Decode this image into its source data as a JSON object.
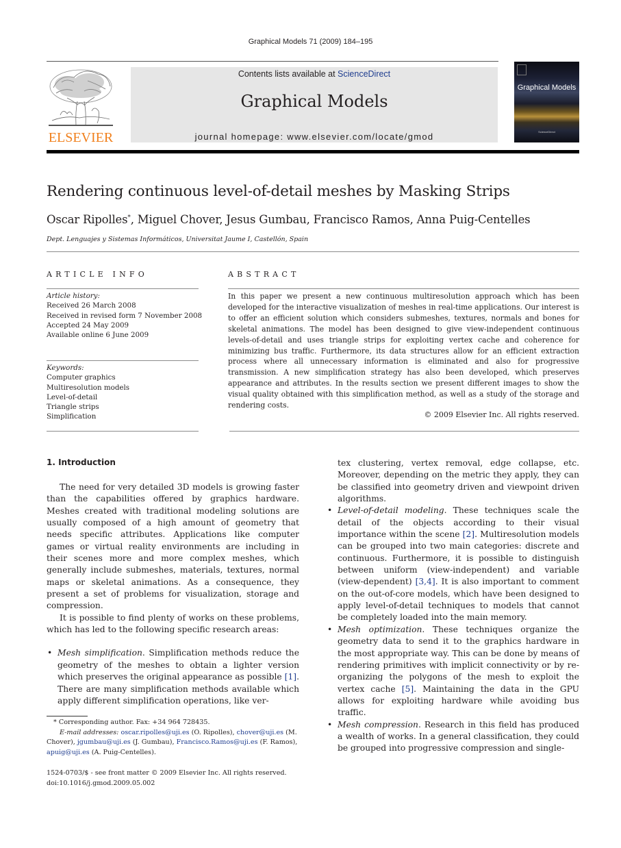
{
  "running_head": "Graphical Models 71 (2009) 184–195",
  "publisher": {
    "logo_icon": "elsevier-tree-logo",
    "name": "ELSEVIER",
    "brand_color": "#f07f1b"
  },
  "banner": {
    "contents_prefix": "Contents lists available at ",
    "contents_link": "ScienceDirect",
    "journal_title": "Graphical Models",
    "homepage": "journal homepage: www.elsevier.com/locate/gmod",
    "background_color": "#e6e6e6",
    "link_color": "#1f3d8f"
  },
  "cover": {
    "title": "Graphical Models",
    "footer": "ScienceDirect"
  },
  "article": {
    "title": "Rendering continuous level-of-detail meshes by Masking Strips",
    "authors": [
      {
        "name": "Oscar Ripolles",
        "mark": "*"
      },
      {
        "name": "Miguel Chover",
        "mark": ""
      },
      {
        "name": "Jesus Gumbau",
        "mark": ""
      },
      {
        "name": "Francisco Ramos",
        "mark": ""
      },
      {
        "name": "Anna Puig-Centelles",
        "mark": ""
      }
    ],
    "affiliation": "Dept. Lenguajes y Sistemas Informáticos, Universitat Jaume I, Castellón, Spain"
  },
  "article_info": {
    "heading": "ARTICLE INFO",
    "history_label": "Article history:",
    "history": [
      "Received 26 March 2008",
      "Received in revised form 7 November 2008",
      "Accepted 24 May 2009",
      "Available online 6 June 2009"
    ],
    "keywords_label": "Keywords:",
    "keywords": [
      "Computer graphics",
      "Multiresolution models",
      "Level-of-detail",
      "Triangle strips",
      "Simplification"
    ]
  },
  "abstract": {
    "heading": "ABSTRACT",
    "text": "In this paper we present a new continuous multiresolution approach which has been developed for the interactive visualization of meshes in real-time applications. Our interest is to offer an efficient solution which considers submeshes, textures, normals and bones for skeletal animations. The model has been designed to give view-independent continuous levels-of-detail and uses triangle strips for exploiting vertex cache and coherence for minimizing bus traffic. Furthermore, its data structures allow for an efficient extraction process where all unnecessary information is eliminated and also for progressive transmission. A new simplification strategy has also been developed, which preserves appearance and attributes. In the results section we present different images to show the visual quality obtained with this simplification method, as well as a study of the storage and rendering costs.",
    "copyright": "© 2009 Elsevier Inc. All rights reserved."
  },
  "body": {
    "section_heading": "1.  Introduction",
    "left_col": {
      "p1": "The need for very detailed 3D models is growing faster than the capabilities offered by graphics hardware. Meshes created with traditional modeling solutions are usually composed of a high amount of geometry that needs specific attributes. Applications like computer games or virtual reality environments are including in their scenes more and more complex meshes, which generally include submeshes, materials, textures, normal maps or skeletal animations. As a consequence, they present a set of problems for visualization, storage and compression.",
      "p2": "It is possible to find plenty of works on these problems, which has led to the following specific research areas:",
      "bullet1": {
        "term": "Mesh simplification",
        "text_a": ". Simplification methods reduce the geometry of the meshes to obtain a lighter version which preserves the original appearance as possible ",
        "cite": "[1]",
        "text_b": ". There are many simplification methods available which apply different simplification operations, like ver-"
      }
    },
    "right_col": {
      "cont": "tex clustering, vertex removal, edge collapse, etc. Moreover, depending on the metric they apply, they can be classified into geometry driven and viewpoint driven algorithms.",
      "bullet2": {
        "term": "Level-of-detail modeling",
        "text_a": ". These techniques scale the detail of the objects according to their visual importance within the scene ",
        "cite1": "[2]",
        "text_b": ". Multiresolution models can be grouped into two main categories: discrete and continuous. Furthermore, it is possible to distinguish between uniform (view-independent) and variable (view-dependent) ",
        "cite2": "[3,4]",
        "text_c": ". It is also important to comment on the out-of-core models, which have been designed to apply level-of-detail techniques to models that cannot be completely loaded into the main memory."
      },
      "bullet3": {
        "term": "Mesh optimization",
        "text_a": ". These techniques organize the geometry data to send it to the graphics hardware in the most appropriate way. This can be done by means of rendering primitives with implicit connectivity or by re-organizing the polygons of the mesh to exploit the vertex cache ",
        "cite": "[5]",
        "text_b": ". Maintaining the data in the GPU allows for exploiting hardware while avoiding bus traffic."
      },
      "bullet4": {
        "term": "Mesh compression",
        "text_a": ". Research in this field has produced a wealth of works. In a general classification, they could be grouped into progressive compression and single-"
      }
    }
  },
  "footnote": {
    "mark": "*",
    "corresponding": "Corresponding author. Fax: +34 964 728435.",
    "email_label": "E-mail addresses:",
    "emails": [
      {
        "address": "oscar.ripolles@uji.es",
        "who": "(O. Ripolles), "
      },
      {
        "address": "chover@uji.es",
        "who": "(M. Chover), "
      },
      {
        "address": "jgumbau@uji.es",
        "who": "(J. Gumbau), "
      },
      {
        "address": "Francisco.Ramos@uji.es",
        "who": "(F. Ramos), "
      },
      {
        "address": "apuig@uji.es",
        "who": "(A. Puig-Centelles)."
      }
    ]
  },
  "front_matter": {
    "issn": "1524-0703/$ - see front matter © 2009 Elsevier Inc. All rights reserved.",
    "doi": "doi:10.1016/j.gmod.2009.05.002"
  }
}
